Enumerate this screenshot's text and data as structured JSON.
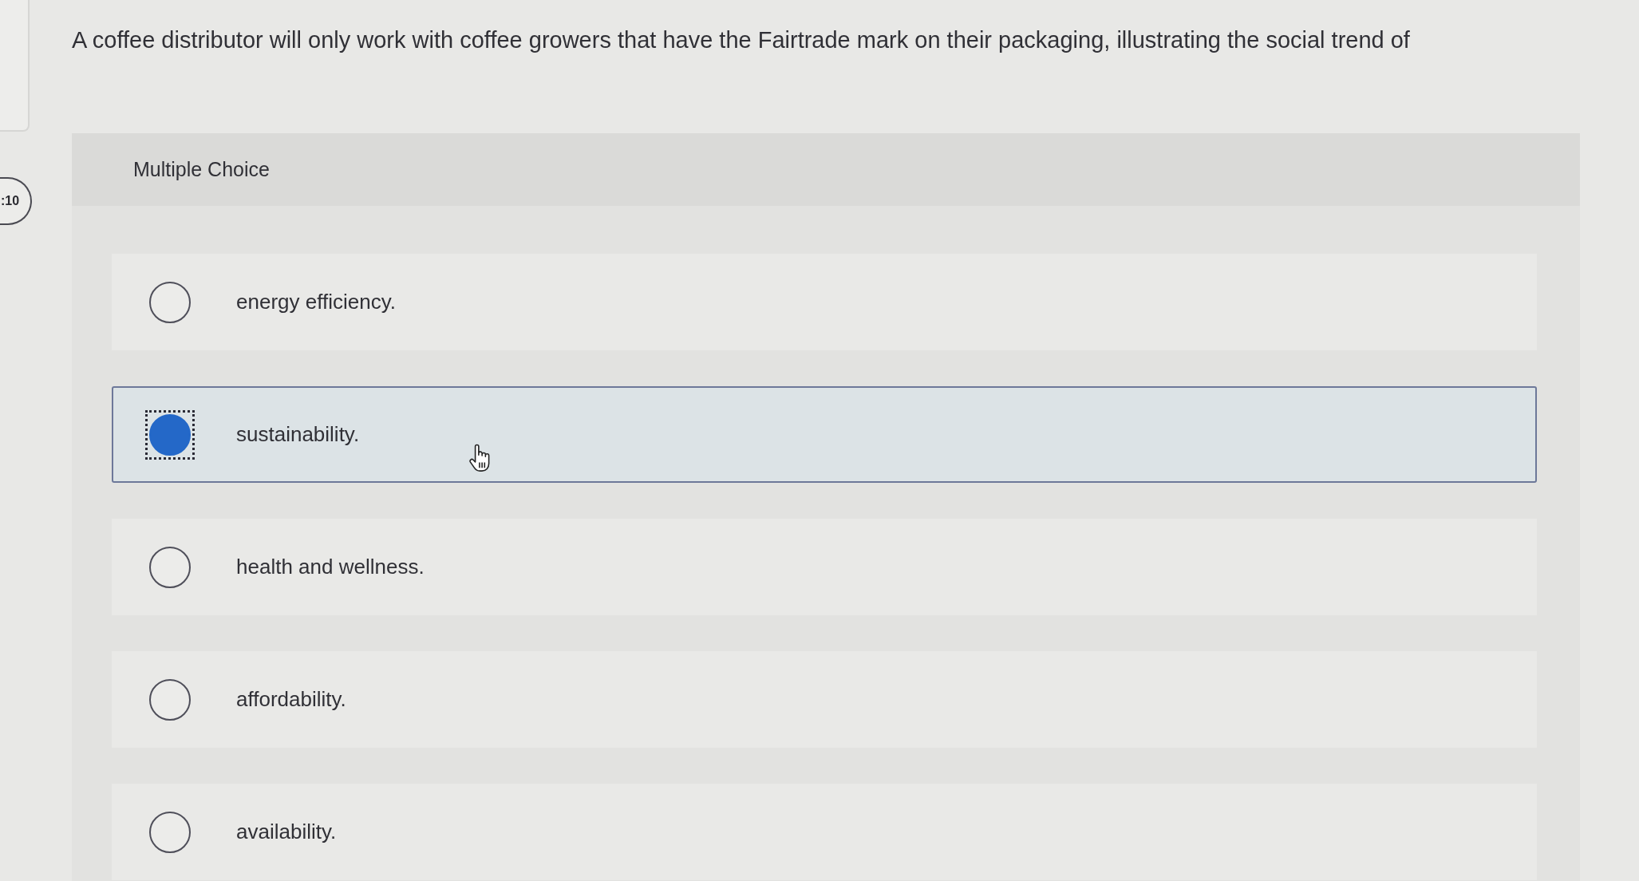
{
  "timer": {
    "text": ":10"
  },
  "question": {
    "text": "A coffee distributor will only work with coffee growers that have the Fairtrade mark on their packaging, illustrating the social trend of"
  },
  "answer_panel": {
    "label": "Multiple Choice",
    "options": [
      {
        "label": "energy efficiency.",
        "selected": false,
        "focused": false
      },
      {
        "label": "sustainability.",
        "selected": true,
        "focused": true
      },
      {
        "label": "health and wellness.",
        "selected": false,
        "focused": false
      },
      {
        "label": "affordability.",
        "selected": false,
        "focused": false
      },
      {
        "label": "availability.",
        "selected": false,
        "focused": false
      }
    ]
  }
}
